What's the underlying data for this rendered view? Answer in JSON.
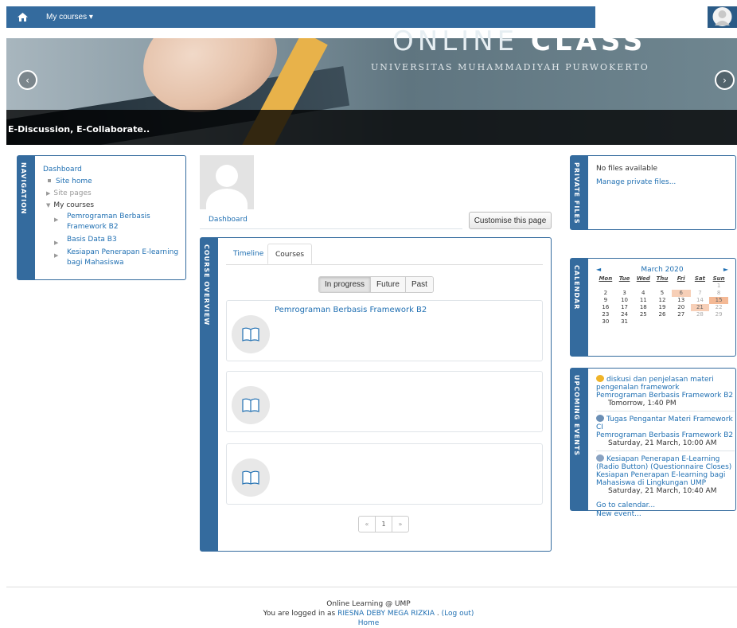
{
  "navbar": {
    "home_icon": "home-icon",
    "my_courses": "My courses ▾"
  },
  "banner": {
    "title_light": "ONLINE",
    "title_bold": "CLASS",
    "subtitle": "UNIVERSITAS MUHAMMADIYAH PURWOKERTO",
    "caption": "E-Discussion, E-Collaborate..",
    "prev": "‹",
    "next": "›"
  },
  "navigation": {
    "heading": "NAVIGATION",
    "dashboard": "Dashboard",
    "site_home": "Site home",
    "site_pages": "Site pages",
    "my_courses": "My courses",
    "courses": [
      "Pemrograman Berbasis Framework B2",
      "Basis Data B3",
      "Kesiapan Penerapan E-learning bagi Mahasiswa"
    ]
  },
  "main": {
    "breadcrumb": "Dashboard",
    "customise_button": "Customise this page",
    "overview_heading": "COURSE OVERVIEW",
    "tabs": [
      "Timeline",
      "Courses"
    ],
    "filters": [
      "In progress",
      "Future",
      "Past"
    ],
    "courses": [
      {
        "name": "Pemrograman Berbasis Framework B2"
      },
      {
        "name": ""
      },
      {
        "name": ""
      }
    ],
    "pager": [
      "«",
      "1",
      "»"
    ]
  },
  "private_files": {
    "heading": "PRIVATE FILES",
    "empty": "No files available",
    "manage": "Manage private files..."
  },
  "calendar": {
    "heading": "CALENDAR",
    "prev": "◄",
    "next": "►",
    "month": "March 2020",
    "day_headers": [
      "Mon",
      "Tue",
      "Wed",
      "Thu",
      "Fri",
      "Sat",
      "Sun"
    ],
    "weeks": [
      [
        "",
        "",
        "",
        "",
        "",
        "",
        "1"
      ],
      [
        "2",
        "3",
        "4",
        "5",
        "6",
        "7",
        "8"
      ],
      [
        "9",
        "10",
        "11",
        "12",
        "13",
        "14",
        "15"
      ],
      [
        "16",
        "17",
        "18",
        "19",
        "20",
        "21",
        "22"
      ],
      [
        "23",
        "24",
        "25",
        "26",
        "27",
        "28",
        "29"
      ],
      [
        "30",
        "31",
        "",
        "",
        "",
        "",
        ""
      ]
    ],
    "event_days": [
      "6",
      "15",
      "21"
    ],
    "today": "15"
  },
  "upcoming": {
    "heading": "UPCOMING EVENTS",
    "events": [
      {
        "title": "diskusi dan penjelasan materi pengenalan framework",
        "course": "Pemrograman Berbasis Framework B2",
        "date": "Tomorrow, 1:40 PM",
        "icon_color": "#f0b429"
      },
      {
        "title": "Tugas Pengantar Materi Framework CI",
        "course": "Pemrograman Berbasis Framework B2",
        "date": "Saturday, 21 March, 10:00 AM",
        "icon_color": "#6b8fb5"
      },
      {
        "title": "Kesiapan Penerapan E-Learning (Radio Button) (Questionnaire Closes)",
        "course": "Kesiapan Penerapan E-learning bagi Mahasiswa di Lingkungan UMP",
        "date": "Saturday, 21 March, 10:40 AM",
        "icon_color": "#8aa3c2"
      }
    ],
    "go_calendar": "Go to calendar...",
    "new_event": "New event..."
  },
  "footer": {
    "site": "Online Learning @ UMP",
    "logged_prefix": "You are logged in as",
    "user": "RIESNA DEBY MEGA RIZKIA",
    "logout": "(Log out)",
    "home": "Home"
  },
  "colors": {
    "brand": "#346b9e",
    "link": "#1f6fb2",
    "calendar_event": "#f7cfb7"
  }
}
